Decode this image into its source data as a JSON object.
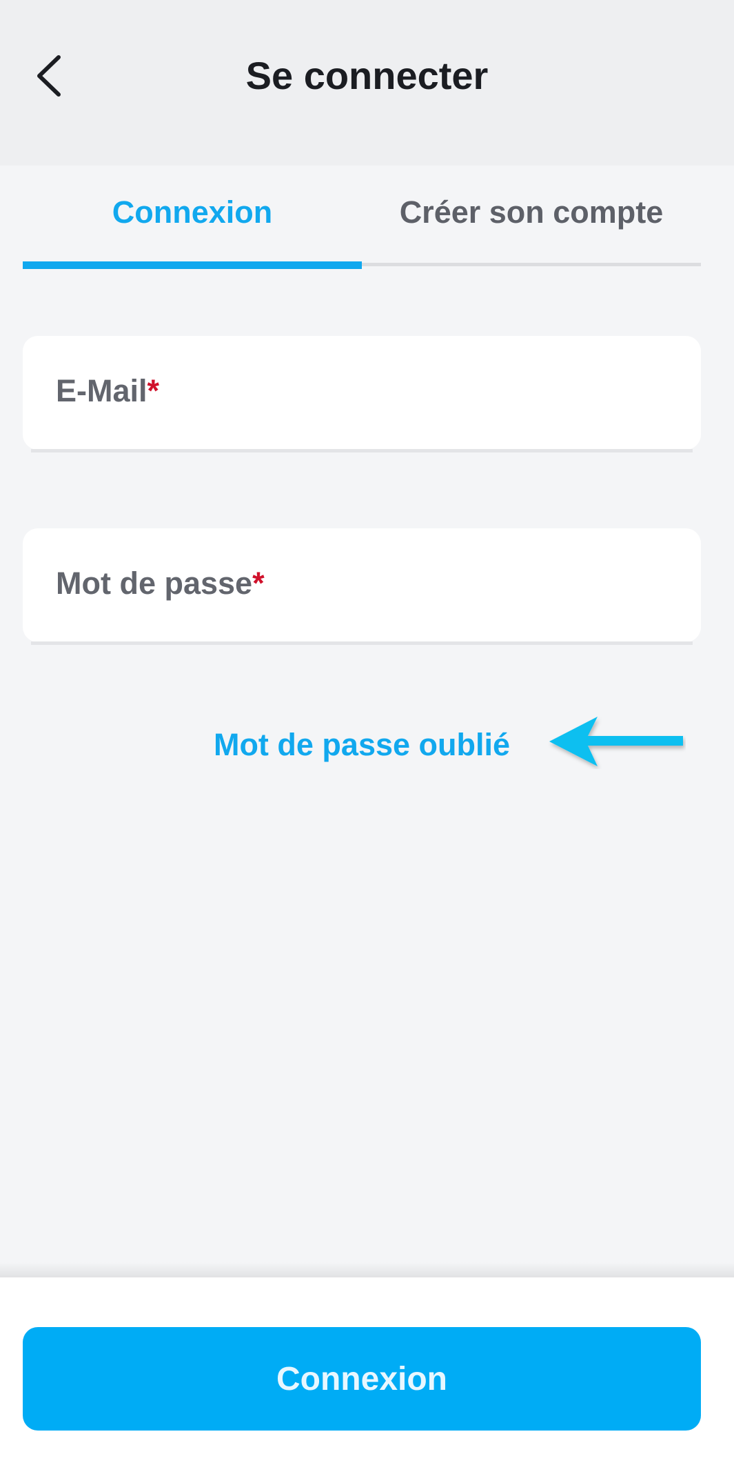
{
  "header": {
    "title": "Se connecter",
    "back_icon": "chevron-left-icon"
  },
  "tabs": [
    {
      "label": "Connexion",
      "active": true
    },
    {
      "label": "Créer son compte",
      "active": false
    }
  ],
  "form": {
    "email": {
      "label": "E-Mail",
      "required_mark": "*",
      "value": ""
    },
    "password": {
      "label": "Mot de passe",
      "required_mark": "*",
      "value": ""
    },
    "forgot_link": "Mot de passe oublié"
  },
  "annotation": {
    "icon": "arrow-left-icon",
    "color": "#0ebff0"
  },
  "footer": {
    "submit_label": "Connexion"
  },
  "colors": {
    "accent": "#11a8ee",
    "button": "#00acf5",
    "required": "#d0112b",
    "background": "#f4f5f7"
  }
}
